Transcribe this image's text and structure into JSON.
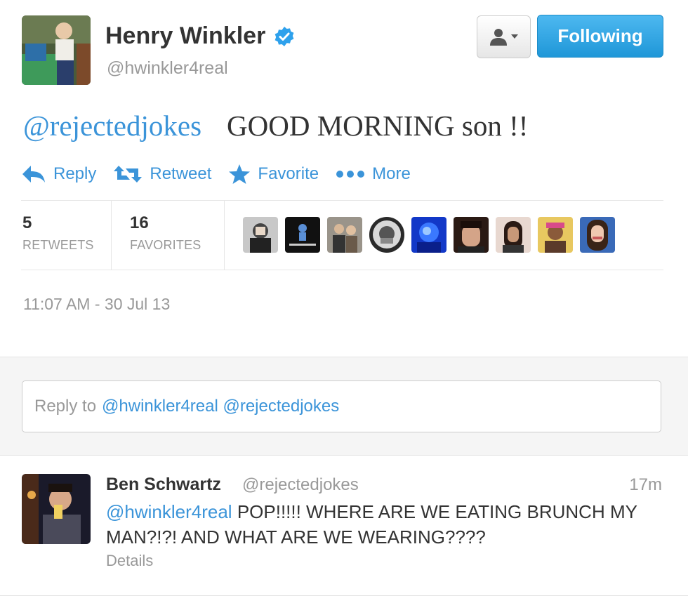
{
  "tweet": {
    "author_name": "Henry Winkler",
    "author_handle": "@hwinkler4real",
    "verified_icon": "verified-badge-icon",
    "follow_button_label": "Following",
    "profile_menu_icon": "person-dropdown-icon",
    "mention": "@rejectedjokes",
    "body": "GOOD MORNING son !!",
    "actions": [
      {
        "label": "Reply",
        "icon": "reply-arrow-icon"
      },
      {
        "label": "Retweet",
        "icon": "retweet-icon"
      },
      {
        "label": "Favorite",
        "icon": "star-icon"
      },
      {
        "label": "More",
        "icon": "more-dots-icon"
      }
    ],
    "stats": {
      "retweets_count": "5",
      "retweets_label": "RETWEETS",
      "favorites_count": "16",
      "favorites_label": "FAVORITES"
    },
    "timestamp": "11:07 AM - 30 Jul 13"
  },
  "reply_box": {
    "prefix": "Reply to",
    "mentions": "@hwinkler4real @rejectedjokes"
  },
  "reply_tweet": {
    "author_name": "Ben Schwartz",
    "author_handle": "@rejectedjokes",
    "time": "17m",
    "mention": "@hwinkler4real",
    "body": "POP!!!!! WHERE ARE WE EATING BRUNCH MY MAN?!?! AND WHAT ARE WE WEARING????",
    "details_link": "Details"
  },
  "colors": {
    "link_blue": "#3b94d9",
    "follow_blue": "#2aa3e6",
    "muted_gray": "#999999"
  }
}
